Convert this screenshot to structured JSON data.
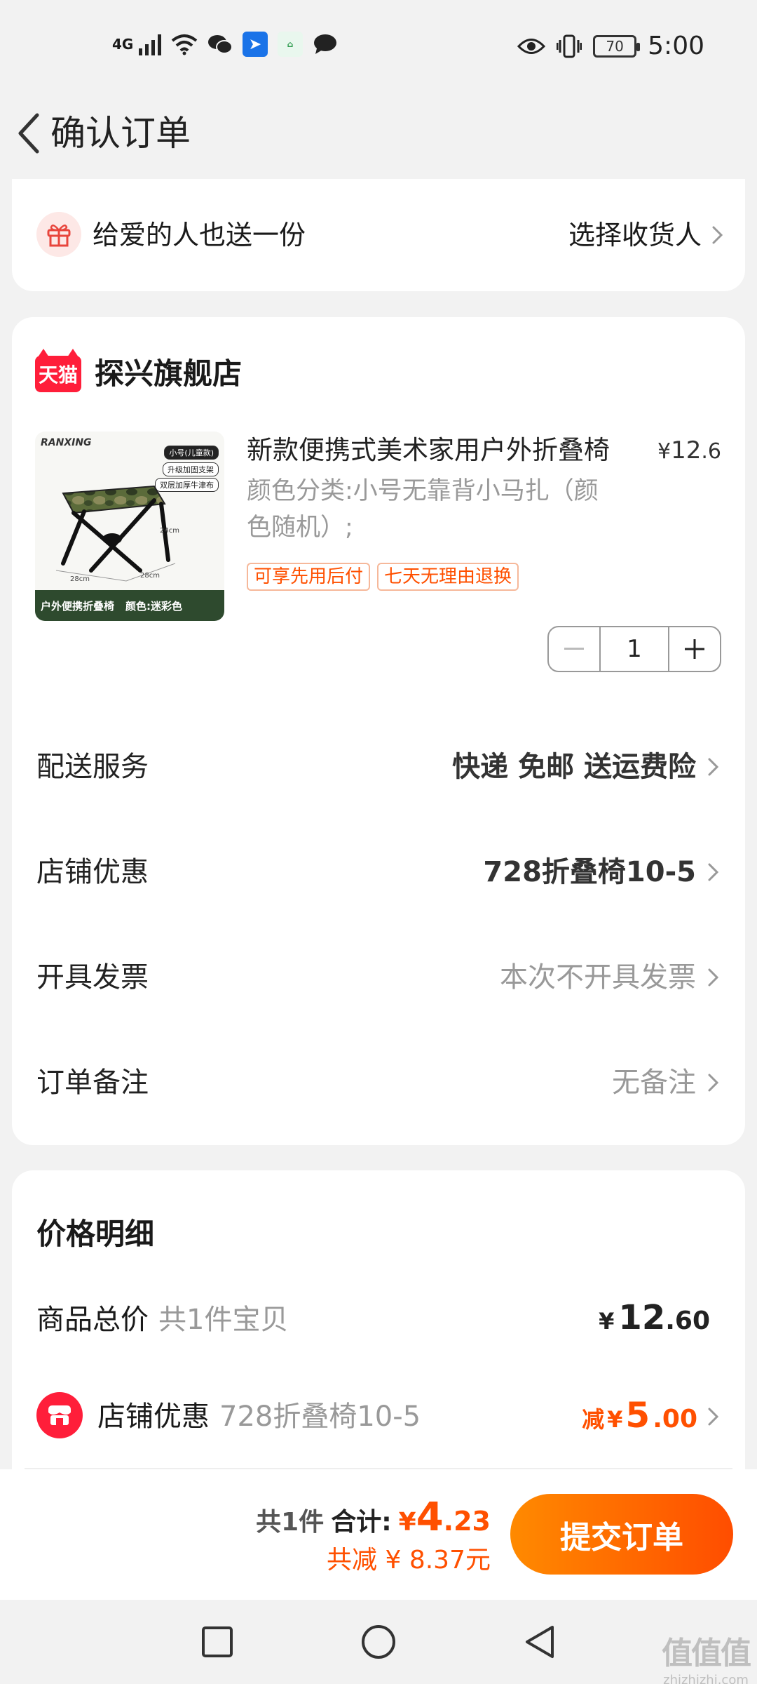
{
  "status_bar": {
    "network": "4G",
    "battery": "70",
    "time": "5:00",
    "icons": [
      "signal-icon",
      "wifi-icon",
      "wechat-icon",
      "app-icon",
      "home-app-icon",
      "chat-icon",
      "eye-icon",
      "vibrate-icon",
      "battery-icon"
    ],
    "app_icon_label": "Welink"
  },
  "header": {
    "title": "确认订单"
  },
  "gift": {
    "text": "给爱的人也送一份",
    "action": "选择收货人"
  },
  "shop": {
    "badge": "天猫",
    "name": "探兴旗舰店",
    "product": {
      "title": "新款便携式美术家用户外折叠椅",
      "price_symbol": "¥",
      "price_int": "12",
      "price_dec": ".6",
      "spec": "颜色分类:小号无靠背小马扎（颜色随机）;",
      "tags": [
        "可享先用后付",
        "七天无理由退换"
      ],
      "quantity": "1",
      "image_text": {
        "brand": "RANXING",
        "tag1": "小号(儿童款)",
        "tag2": "升级加固支架",
        "tag3": "双层加厚牛津布",
        "footer1": "户外便携折叠椅",
        "footer2": "颜色:迷彩色",
        "dim1": "24cm",
        "dim2": "28cm",
        "dim3": "28cm"
      }
    },
    "rows": [
      {
        "label": "配送服务",
        "value": "快递 免邮 送运费险",
        "style": "bold"
      },
      {
        "label": "店铺优惠",
        "value": "728折叠椅10-5",
        "style": "bold"
      },
      {
        "label": "开具发票",
        "value": "本次不开具发票",
        "style": "muted"
      },
      {
        "label": "订单备注",
        "value": "无备注",
        "style": "muted"
      }
    ]
  },
  "price_detail": {
    "title": "价格明细",
    "goods_total": {
      "label": "商品总价",
      "sub": "共1件宝贝",
      "currency": "¥",
      "int": "12",
      "dec": ".60"
    },
    "shop_discount": {
      "label": "店铺优惠",
      "sub": "728折叠椅10-5",
      "prefix": "减",
      "currency": "¥",
      "int": "5",
      "dec": ".00"
    }
  },
  "bottom_bar": {
    "count": "共1件",
    "total_label": "合计:",
    "currency": "¥",
    "total_int": "4",
    "total_dec": ".23",
    "saved": "共减 ¥ 8.37元",
    "submit": "提交订单"
  },
  "nav": {
    "watermark": "值值值",
    "watermark_url": "zhizhizhi.com"
  },
  "colors": {
    "accent": "#ff5000",
    "tmall": "#ff1e3a",
    "background": "#f2f2f2"
  }
}
